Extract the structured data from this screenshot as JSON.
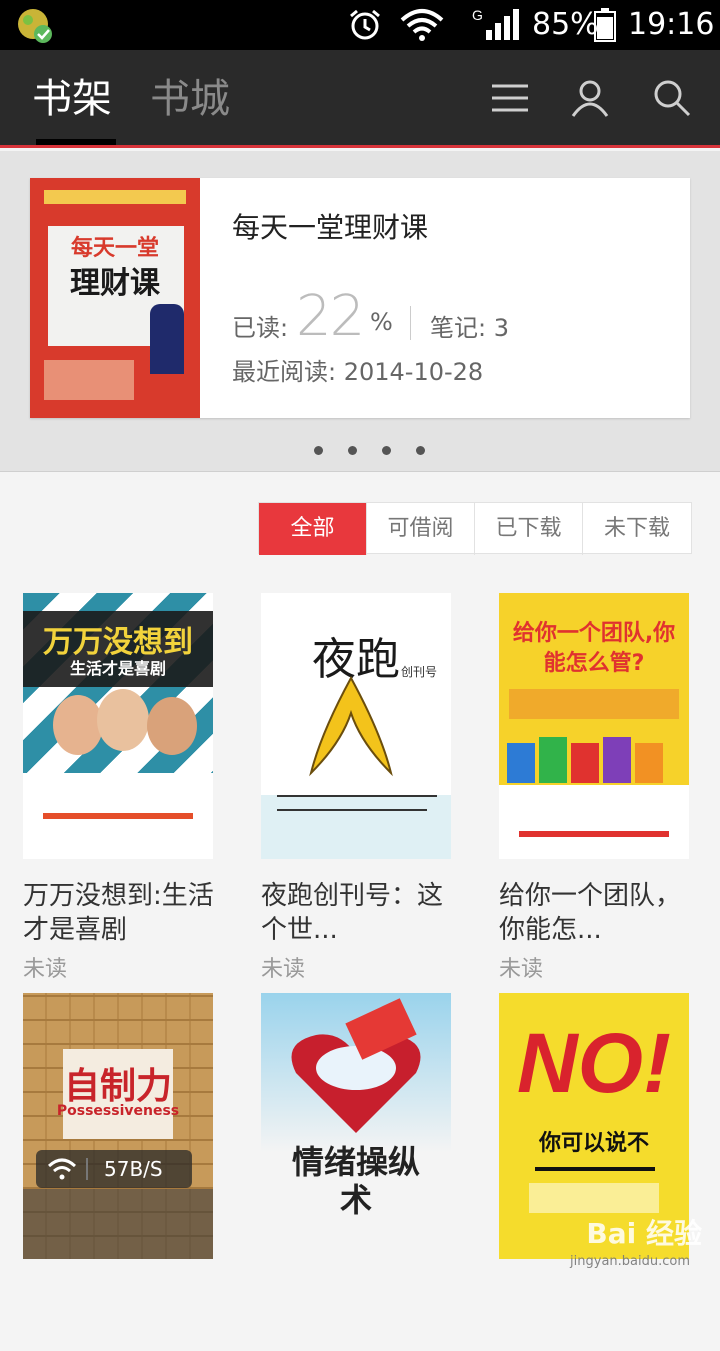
{
  "status_bar": {
    "battery_percent": "85%",
    "time": "19:16",
    "signal_badge": "G"
  },
  "nav": {
    "tabs": [
      "书架",
      "书城"
    ],
    "icons": [
      "menu-icon",
      "user-icon",
      "search-icon"
    ]
  },
  "featured": {
    "title": "每天一堂理财课",
    "read_label": "已读:",
    "read_value": "22",
    "read_unit": "%",
    "notes": "笔记: 3",
    "recent": "最近阅读: 2014-10-28",
    "cover_title_line1": "每天一堂",
    "cover_title_line2": "理财课",
    "page_count": 4
  },
  "filters": [
    "全部",
    "可借阅",
    "已下载",
    "未下载"
  ],
  "books": [
    {
      "title": "万万没想到:生活才是喜剧",
      "status": "未读",
      "cover_text": "万万没想到",
      "cover_sub": "生活才是喜剧"
    },
    {
      "title": "夜跑创刊号：这个世...",
      "status": "未读",
      "cover_text": "夜跑",
      "cover_sub": "创刊号"
    },
    {
      "title": "给你一个团队，你能怎...",
      "status": "未读",
      "cover_text": "给你一个团队,你能怎么管?",
      "cover_sub": ""
    },
    {
      "title": "",
      "status": "",
      "cover_text": "自制力",
      "cover_sub": "Possessiveness"
    },
    {
      "title": "",
      "status": "",
      "cover_text": "情绪操纵术",
      "cover_sub": ""
    },
    {
      "title": "",
      "status": "",
      "cover_text": "NO!",
      "cover_sub": "你可以说不"
    }
  ],
  "network_speed": "57B/S",
  "watermark": "Bai 经验",
  "watermark_url": "jingyan.baidu.com",
  "colors": {
    "accent": "#e8383d",
    "nav_bg": "#2a2a2a"
  }
}
